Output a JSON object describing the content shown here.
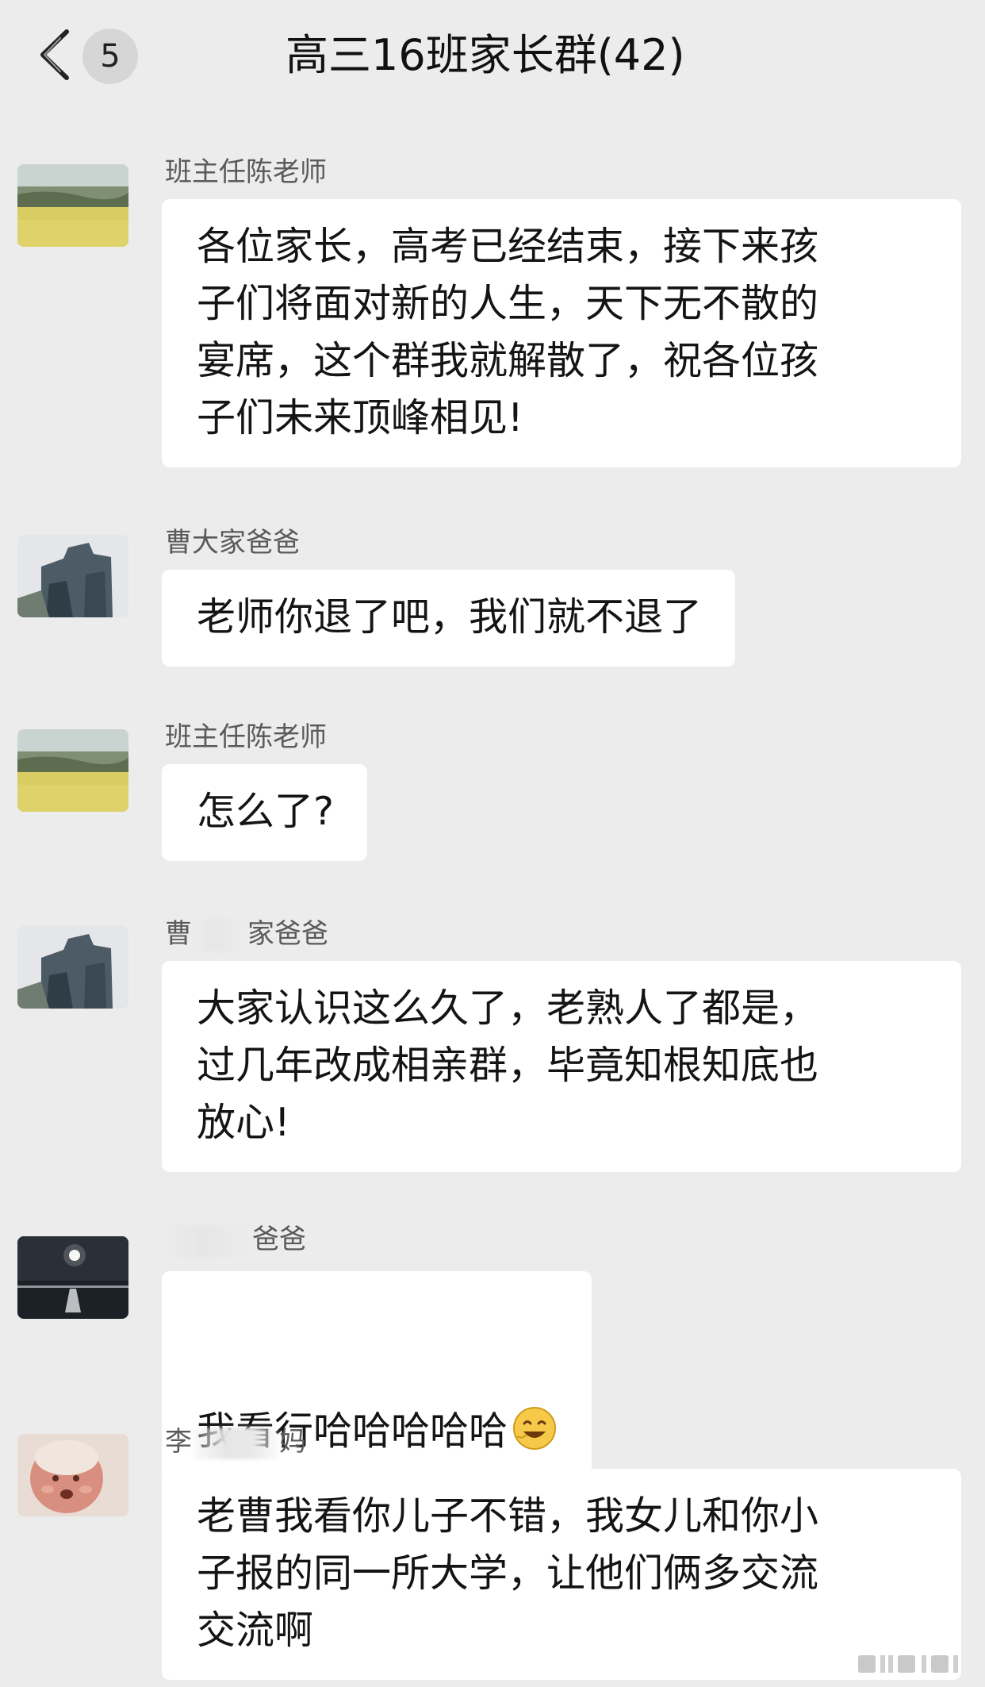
{
  "header": {
    "title": "高三16班家长群(42)",
    "unread_count": "5",
    "back_icon": "chevron-left-icon"
  },
  "messages": [
    {
      "sender": "班主任陈老师",
      "text": "各位家长，高考已经结束，接下来孩\n子们将面对新的人生，天下无不散的\n宴席，这个群我就解散了，祝各位孩\n子们未来顶峰相见!"
    },
    {
      "sender": "曹大家爸爸",
      "text": "老师你退了吧，我们就不退了"
    },
    {
      "sender": "班主任陈老师",
      "text": "怎么了?"
    },
    {
      "sender_visible_start": "曹",
      "sender_visible_end": "家爸爸",
      "text": "大家认识这么久了，老熟人了都是，\n过几年改成相亲群，毕竟知根知底也\n放心!"
    },
    {
      "sender_visible_end": "爸爸",
      "text": "我看行哈哈哈哈哈",
      "emoji": "grinning-face-emoji"
    },
    {
      "sender_visible_start": "李",
      "sender_visible_end": "妈",
      "text": "老曹我看你儿子不错，我女儿和你小\n子报的同一所大学，让他们俩多交流\n交流啊"
    }
  ],
  "colors": {
    "background": "#ececec",
    "bubble": "#ffffff",
    "sender_text": "#5a5a5a"
  }
}
